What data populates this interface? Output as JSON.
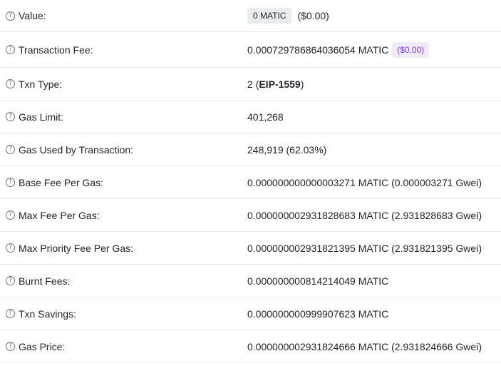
{
  "rows": {
    "value": {
      "label": "Value:",
      "amount": "0 MATIC",
      "usd": "($0.00)"
    },
    "fee": {
      "label": "Transaction Fee:",
      "amount": "0.000729786864036054 MATIC",
      "usd": "($0.00)"
    },
    "txn_type": {
      "label": "Txn Type:",
      "prefix": "2 (",
      "type_name": "EIP-1559",
      "suffix": ")"
    },
    "gas_limit": {
      "label": "Gas Limit:",
      "amount": "401,268"
    },
    "gas_used": {
      "label": "Gas Used by Transaction:",
      "amount": "248,919 (62.03%)"
    },
    "base_fee": {
      "label": "Base Fee Per Gas:",
      "amount": "0.000000000000003271 MATIC (0.000003271 Gwei)"
    },
    "max_fee": {
      "label": "Max Fee Per Gas:",
      "amount": "0.000000002931828683 MATIC (2.931828683 Gwei)"
    },
    "max_priority": {
      "label": "Max Priority Fee Per Gas:",
      "amount": "0.000000002931821395 MATIC (2.931821395 Gwei)"
    },
    "burnt": {
      "label": "Burnt Fees:",
      "amount": "0.000000000814214049 MATIC"
    },
    "savings": {
      "label": "Txn Savings:",
      "amount": "0.000000000999907623 MATIC"
    },
    "gas_price": {
      "label": "Gas Price:",
      "amount": "0.000000002931824666 MATIC (2.931824666 Gwei)"
    }
  },
  "icons": {
    "help": "question-circle-icon",
    "help_glyph": "?"
  },
  "colors": {
    "accent": "#7b3fe4",
    "pill_bg": "#e9ecef",
    "border": "#e9ecef"
  }
}
